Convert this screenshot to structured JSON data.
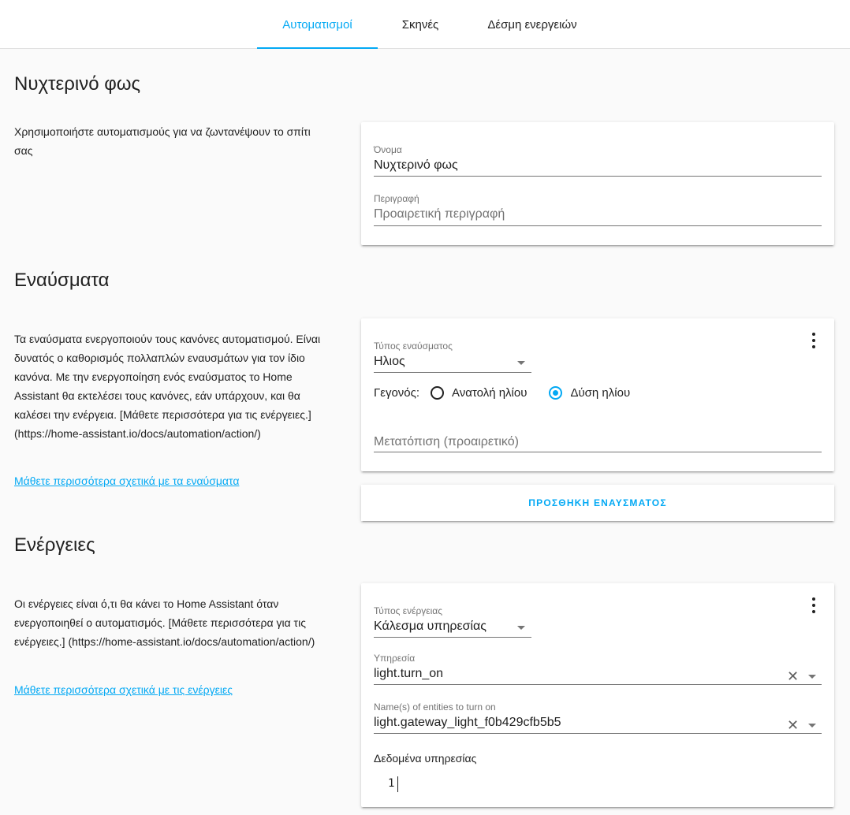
{
  "tabs": [
    {
      "label": "Αυτοματισμοί",
      "active": true
    },
    {
      "label": "Σκηνές",
      "active": false
    },
    {
      "label": "Δέσμη ενεργειών",
      "active": false
    }
  ],
  "automation": {
    "title": "Νυχτερινό φως",
    "description": "Χρησιμοποιήστε αυτοματισμούς για να ζωντανέψουν το σπίτι σας",
    "name_label": "Όνομα",
    "name_value": "Νυχτερινό φως",
    "desc_label": "Περιγραφή",
    "desc_placeholder": "Προαιρετική περιγραφή"
  },
  "triggers": {
    "title": "Εναύσματα",
    "description": "Τα εναύσματα ενεργοποιούν τους κανόνες αυτοματισμού. Είναι δυνατός ο καθορισμός πολλαπλών εναυσμάτων για τον ίδιο κανόνα. Με την ενεργοποίηση ενός εναύσματος το Home Assistant θα εκτελέσει τους κανόνες, εάν υπάρχουν, και θα καλέσει την ενέργεια. [Μάθετε περισσότερα για τις ενέργειες.] (https://home-assistant.io/docs/automation/action/)",
    "learn_more": "Μάθετε περισσότερα σχετικά με τα εναύσματα",
    "type_label": "Τύπος εναύσματος",
    "type_value": "Ηλιος",
    "event_label": "Γεγονός:",
    "options": [
      {
        "label": "Ανατολή ηλίου",
        "checked": false
      },
      {
        "label": "Δύση ηλίου",
        "checked": true
      }
    ],
    "offset_placeholder": "Μετατόπιση (προαιρετικό)",
    "add_button": "ΠΡΟΣΘΗΚΗ ΕΝΑΥΣΜΑΤΟΣ"
  },
  "actions": {
    "title": "Ενέργειες",
    "description": "Οι ενέργειες είναι ό,τι θα κάνει το Home Assistant όταν ενεργοποιηθεί ο αυτοματισμός. [Μάθετε περισσότερα για τις ενέργειες.] (https://home-assistant.io/docs/automation/action/)",
    "learn_more": "Μάθετε περισσότερα σχετικά με τις ενέργειες",
    "type_label": "Τύπος ενέργειας",
    "type_value": "Κάλεσμα υπηρεσίας",
    "service_label": "Υπηρεσία",
    "service_value": "light.turn_on",
    "entities_label": "Name(s) of entities to turn on",
    "entities_value": "light.gateway_light_f0b429cfb5b5",
    "data_label": "Δεδομένα υπηρεσίας",
    "line_number": "1"
  },
  "colors": {
    "accent": "#03a9f4",
    "background": "#fafafa",
    "card": "#ffffff"
  },
  "icons": [
    "more-vert-icon",
    "dropdown-arrow-icon",
    "clear-icon"
  ]
}
